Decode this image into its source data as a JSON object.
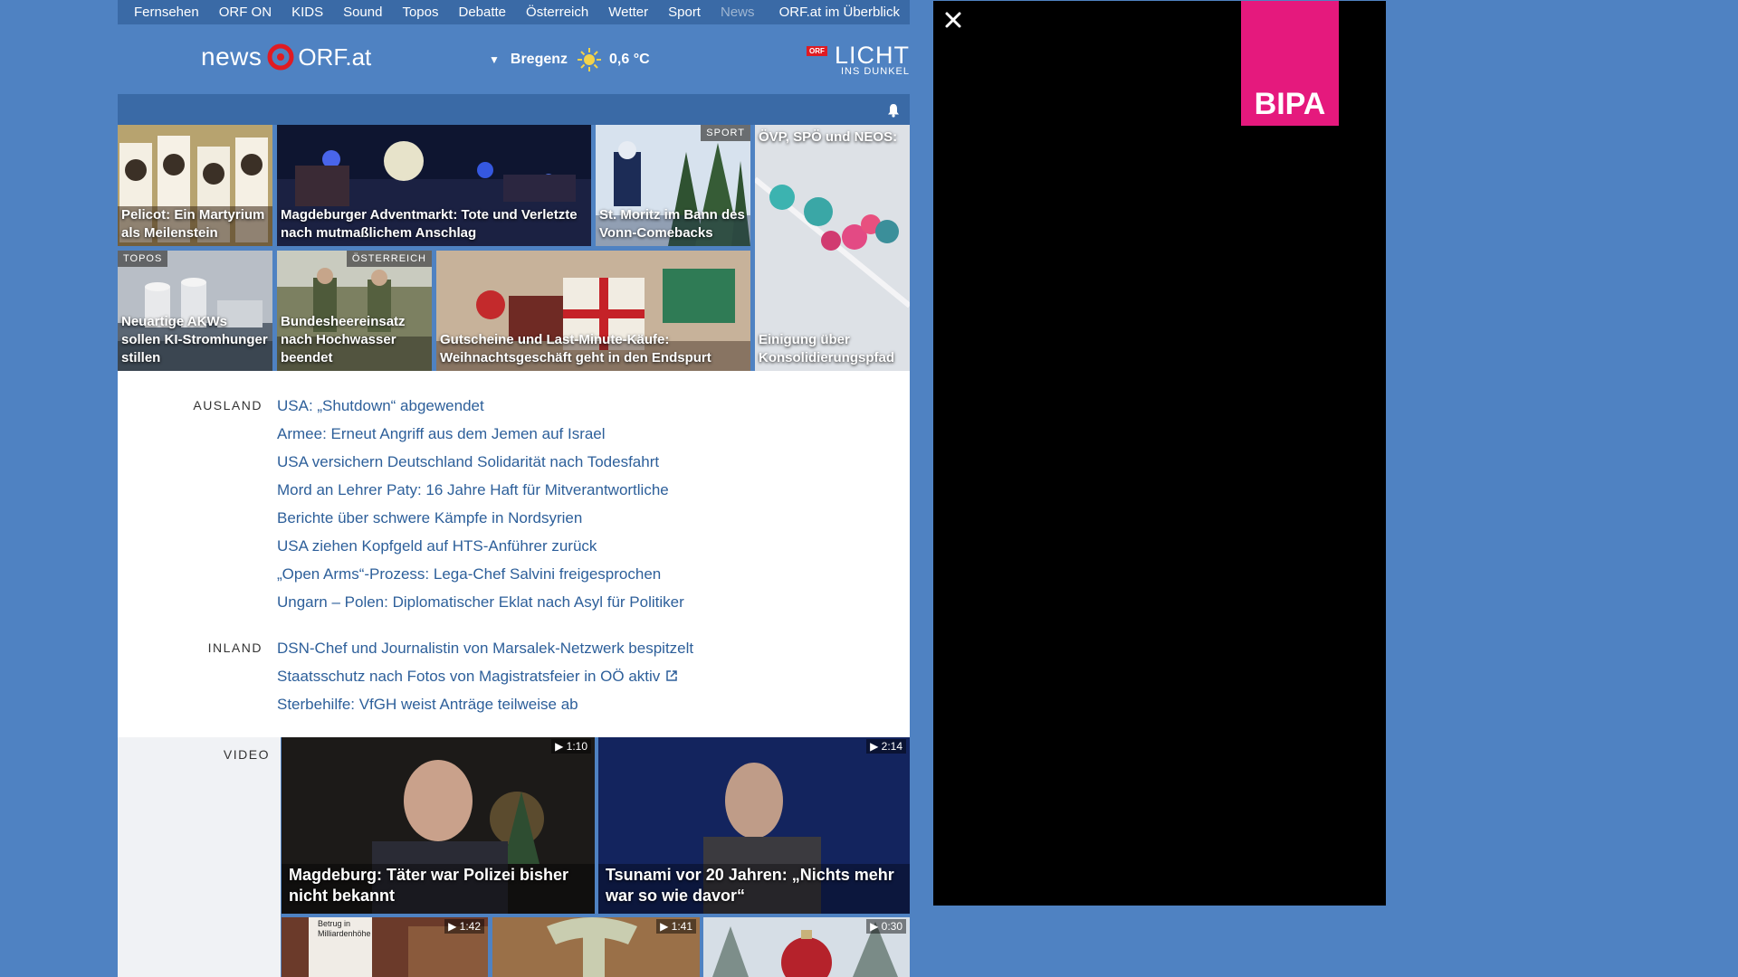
{
  "topnav": {
    "items": [
      "Fernsehen",
      "ORF ON",
      "KIDS",
      "Sound",
      "Topos",
      "Debatte",
      "Österreich",
      "Wetter",
      "Sport",
      "News"
    ],
    "overview": "ORF.at im Überblick"
  },
  "header": {
    "logo_news": "news",
    "logo_orf": "ORF.at",
    "weather": {
      "location": "Bregenz",
      "temperature": "0,6 °C"
    },
    "licht": {
      "tag": "ORF",
      "big": "LICHT",
      "small": "INS DUNKEL"
    }
  },
  "tiles": [
    {
      "title": "Pelicot: Ein Martyrium als Meilenstein",
      "tag": ""
    },
    {
      "title": "Magdeburger Adventmarkt: Tote und Verletzte nach mutmaßlichem Anschlag",
      "tag": ""
    },
    {
      "title": "St. Moritz im Bann des Vonn-Comebacks",
      "tag": "SPORT"
    },
    {
      "title": "ÖVP, SPÖ und NEOS:",
      "tag": ""
    },
    {
      "title": "Einigung über Konsolidierungspfad",
      "tag": ""
    },
    {
      "title": "Neuartige AKWs sollen KI-Stromhunger stillen",
      "tag": "TOPOS"
    },
    {
      "title": "Bundesheereinsatz nach Hochwasser beendet",
      "tag": "ÖSTERREICH"
    },
    {
      "title": "Gutscheine und Last-Minute-Käufe: Weihnachtsgeschäft geht in den Endspurt",
      "tag": ""
    }
  ],
  "ausland": {
    "label": "AUSLAND",
    "items": [
      "USA: „Shutdown“ abgewendet",
      "Armee: Erneut Angriff aus dem Jemen auf Israel",
      "USA versichern Deutschland Solidarität nach Todesfahrt",
      "Mord an Lehrer Paty: 16 Jahre Haft für Mitverantwortliche",
      "Berichte über schwere Kämpfe in Nordsyrien",
      "USA ziehen Kopfgeld auf HTS-Anführer zurück",
      "„Open Arms“-Prozess: Lega-Chef Salvini freigesprochen",
      "Ungarn – Polen: Diplomatischer Eklat nach Asyl für Politiker"
    ]
  },
  "inland": {
    "label": "INLAND",
    "items": [
      "DSN-Chef und Journalistin von Marsalek-Netzwerk bespitzelt",
      "Staatsschutz nach Fotos von Magistratsfeier in OÖ aktiv",
      "Sterbehilfe: VfGH weist Anträge teilweise ab"
    ]
  },
  "video": {
    "label": "VIDEO",
    "items": [
      {
        "duration": "1:10",
        "title": "Magdeburg: Täter war Polizei bisher nicht bekannt"
      },
      {
        "duration": "2:14",
        "title": "Tsunami vor 20 Jahren: „Nichts mehr war so wie davor“"
      },
      {
        "duration": "1:42",
        "title": "",
        "overlay": "Betrug in Milliardenhöhe"
      },
      {
        "duration": "1:41",
        "title": ""
      },
      {
        "duration": "0:30",
        "title": ""
      }
    ]
  },
  "ad": {
    "brand": "BIPA"
  }
}
